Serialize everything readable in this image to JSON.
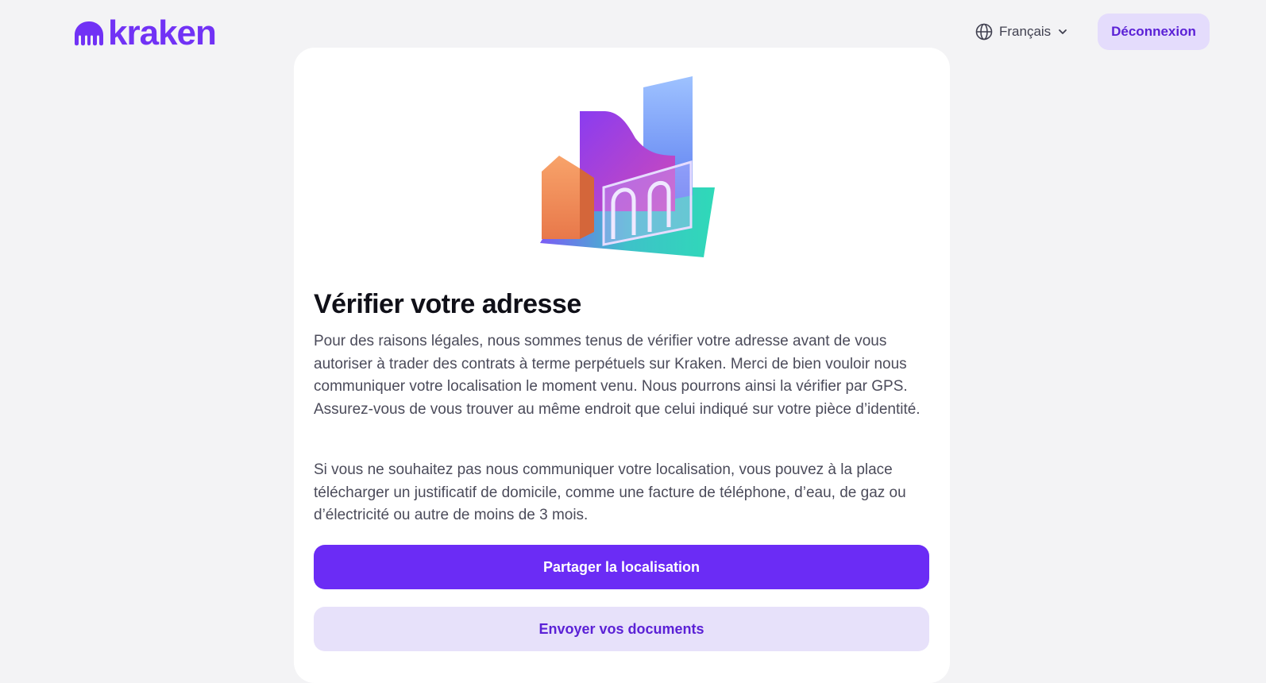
{
  "header": {
    "logo_text": "kraken",
    "language": {
      "label": "Français",
      "icon": "globe-icon"
    },
    "logout_label": "Déconnexion"
  },
  "main": {
    "title": "Vérifier votre adresse",
    "paragraph1": "Pour des raisons légales, nous sommes tenus de vérifier votre adresse avant de vous autoriser à trader des contrats à terme perpétuels sur Kraken. Merci de bien vouloir nous communiquer votre localisation le moment venu. Nous pourrons ainsi la vérifier par GPS. Assurez-vous de vous trouver au même endroit que celui indiqué sur votre pièce d’identité.",
    "paragraph2": "Si vous ne souhaitez pas nous communiquer votre localisation, vous pouvez à la place télécharger un justificatif de domicile, comme une facture de téléphone, d’eau, de gaz ou d’électricité ou autre de moins de 3 mois.",
    "primary_button": "Partager la localisation",
    "secondary_button": "Envoyer vos documents"
  },
  "colors": {
    "brand": "#7132f5",
    "primary_button_bg": "#6b2cf5",
    "secondary_button_bg": "#e7e1fa",
    "page_bg": "#f3f3f5"
  }
}
